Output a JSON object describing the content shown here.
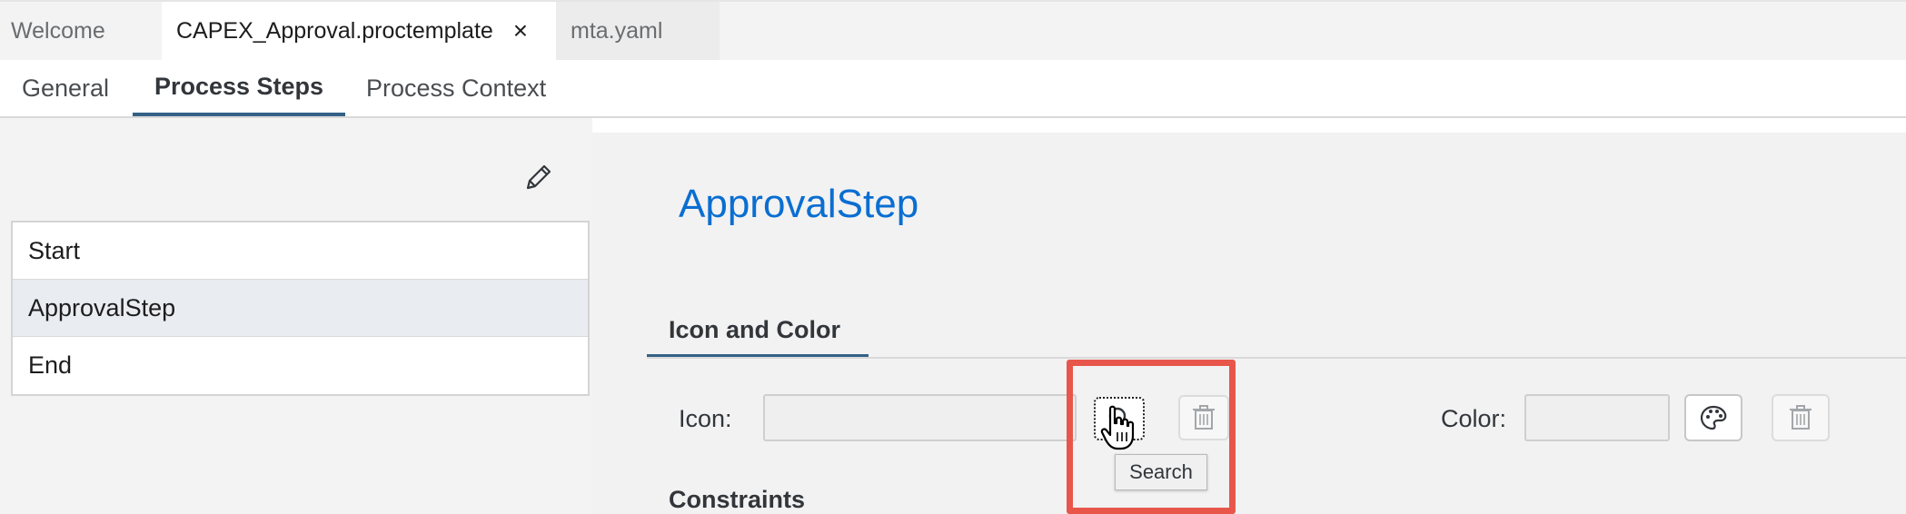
{
  "editor_tabs": [
    {
      "label": "Welcome"
    },
    {
      "label": "CAPEX_Approval.proctemplate",
      "close": "×"
    },
    {
      "label": "mta.yaml"
    }
  ],
  "sub_tabs": [
    {
      "label": "General"
    },
    {
      "label": "Process Steps"
    },
    {
      "label": "Process Context"
    }
  ],
  "steps": [
    {
      "label": "Start"
    },
    {
      "label": "ApprovalStep"
    },
    {
      "label": "End"
    }
  ],
  "detail": {
    "title": "ApprovalStep",
    "section_tab": "Icon and Color",
    "icon_label": "Icon:",
    "icon_value": "",
    "color_label": "Color:",
    "color_value": "",
    "tooltip": "Search",
    "constraints_heading": "Constraints"
  },
  "icons": {
    "edit": "pencil-icon",
    "search": "search-icon",
    "delete": "trash-icon",
    "palette": "palette-icon",
    "cursor": "hand-pointer-icon"
  },
  "colors": {
    "accent": "#0a6ed1",
    "tab_underline": "#346187",
    "highlight": "#e8564b",
    "selected_row": "#e9ecf0"
  }
}
